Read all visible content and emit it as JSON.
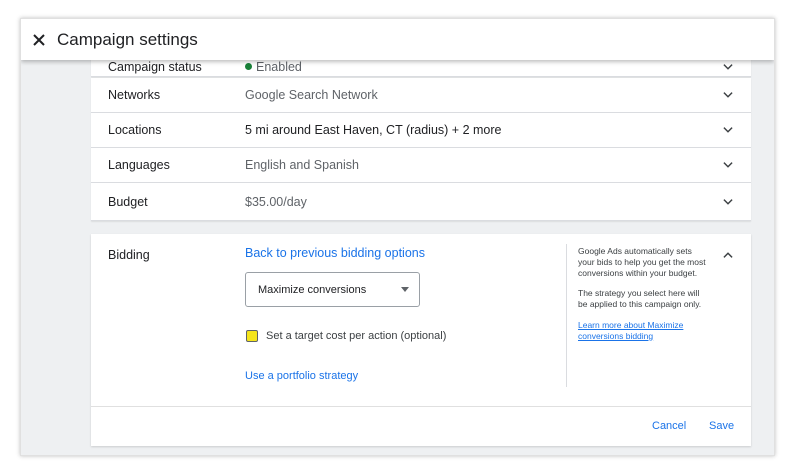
{
  "header": {
    "title": "Campaign settings",
    "close_icon": "close-icon"
  },
  "rows": [
    {
      "label": "Campaign status",
      "value": "Enabled",
      "status_color": "#188038"
    },
    {
      "label": "Networks",
      "value": "Google Search Network"
    },
    {
      "label": "Locations",
      "value": "5 mi around East Haven, CT (radius) + 2 more"
    },
    {
      "label": "Languages",
      "value": "English and Spanish"
    },
    {
      "label": "Budget",
      "value": "$35.00/day"
    }
  ],
  "bidding": {
    "label": "Bidding",
    "back_link": "Back to previous bidding options",
    "strategy_selected": "Maximize conversions",
    "checkbox_label": "Set a target cost per action (optional)",
    "checkbox_checked": false,
    "portfolio_link": "Use a portfolio strategy",
    "help_text_1": "Google Ads automatically sets your bids to help you get the most conversions within your budget.",
    "help_text_2": "The strategy you select here will be applied to this campaign only.",
    "help_link": "Learn more about Maximize conversions bidding",
    "cancel_label": "Cancel",
    "save_label": "Save"
  },
  "colors": {
    "accent": "#1a73e8",
    "checkbox_highlight": "#f5e51c",
    "enabled": "#188038"
  }
}
